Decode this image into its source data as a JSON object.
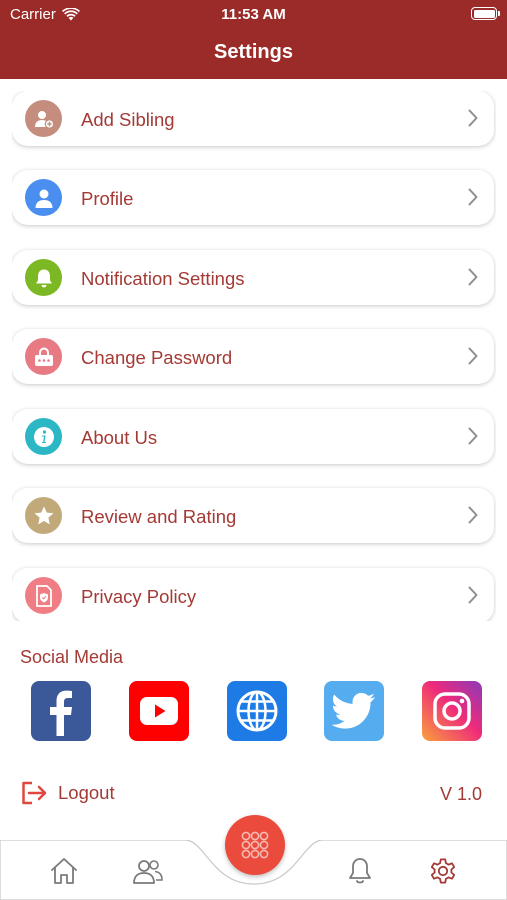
{
  "status_bar": {
    "carrier": "Carrier",
    "time": "11:53 AM"
  },
  "header": {
    "title": "Settings"
  },
  "menu": [
    {
      "label": "Add Sibling",
      "icon": "add-user-icon",
      "color": "#c48d7e"
    },
    {
      "label": "Profile",
      "icon": "user-icon",
      "color": "#4a8ef0"
    },
    {
      "label": "Notification Settings",
      "icon": "bell-icon",
      "color": "#7cb724"
    },
    {
      "label": "Change Password",
      "icon": "lock-icon",
      "color": "#e77a83"
    },
    {
      "label": "About Us",
      "icon": "info-icon",
      "color": "#2bb7c4"
    },
    {
      "label": "Review and Rating",
      "icon": "star-icon",
      "color": "#c2a97a"
    },
    {
      "label": "Privacy Policy",
      "icon": "shield-document-icon",
      "color": "#f07d83"
    }
  ],
  "social": {
    "title": "Social Media",
    "items": [
      {
        "name": "facebook-icon",
        "color": "#3b5998"
      },
      {
        "name": "youtube-icon",
        "color": "#ff0000"
      },
      {
        "name": "globe-icon",
        "color": "#1e7be6"
      },
      {
        "name": "twitter-icon",
        "color": "#55acee"
      },
      {
        "name": "instagram-icon",
        "color": "#d6249f"
      }
    ]
  },
  "footer": {
    "logout_label": "Logout",
    "version": "V 1.0"
  },
  "colors": {
    "header": "#9b2b28",
    "accent": "#a33a35",
    "fab": "#ea4b3c"
  }
}
